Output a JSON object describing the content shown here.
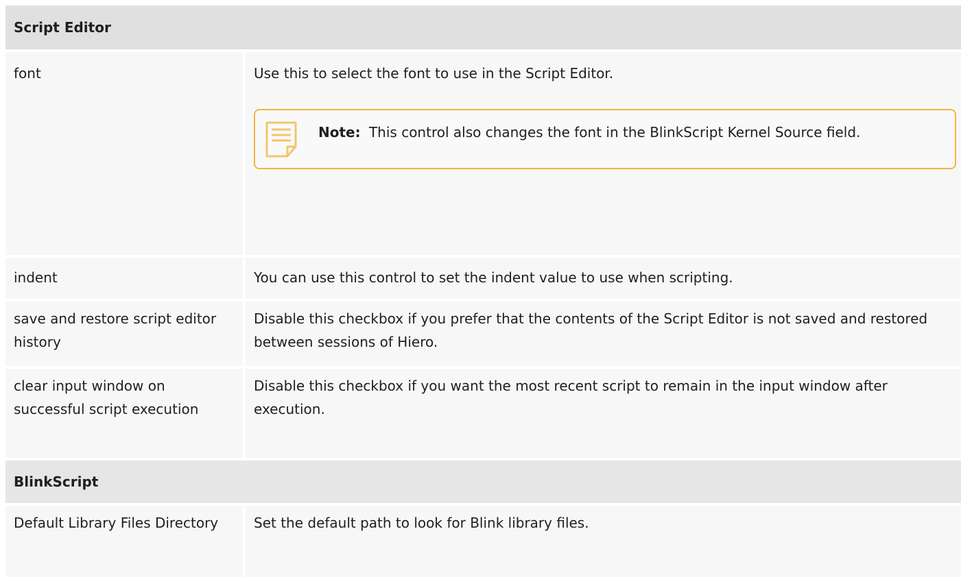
{
  "sections": [
    {
      "title": "Script Editor",
      "rows": [
        {
          "name": "font",
          "desc": "Use this to select the font to use in the Script Editor.",
          "note": {
            "label": "Note:",
            "text": "This control also changes the font in the BlinkScript Kernel Source field.",
            "icon": "note-icon"
          }
        },
        {
          "name": "indent",
          "desc": "You can use this control to set the indent value to use when scripting."
        },
        {
          "name": "save and restore script editor history",
          "desc": "Disable this checkbox if you prefer that the contents of the Script Editor is not saved and restored between sessions of Hiero."
        },
        {
          "name": "clear input window on successful script execution",
          "desc": "Disable this checkbox if you want the most recent script to remain in the input window after execution."
        }
      ]
    },
    {
      "title": "BlinkScript",
      "rows": [
        {
          "name": "Default Library Files Directory",
          "desc": "Set the default path to look for Blink library files."
        }
      ]
    }
  ],
  "colors": {
    "header_bg": "#e0e0e0",
    "row_bg": "#f7f7f7",
    "note_border": "#f2b640"
  }
}
